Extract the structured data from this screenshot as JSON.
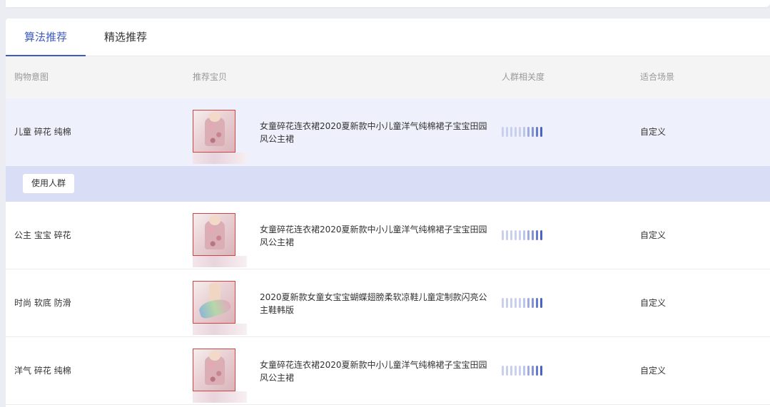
{
  "tabs": [
    {
      "label": "算法推荐",
      "active": true
    },
    {
      "label": "精选推荐",
      "active": false
    }
  ],
  "columns": {
    "intent": "购物意图",
    "product": "推荐宝贝",
    "relevance": "人群相关度",
    "scene": "适合场景"
  },
  "colors": {
    "accent": "#3d5ac1",
    "bar_light": "#c9d0ee",
    "bar_dark": "#4a62c6",
    "highlight_row": "#eef1fb",
    "action_row": "#d9ddf5"
  },
  "action": {
    "use_crowd_label": "使用人群"
  },
  "rows": [
    {
      "intent": "儿童 碎花 纯棉",
      "title": "女童碎花连衣裙2020夏新款中小儿童洋气纯棉裙子宝宝田园风公主裙",
      "thumb": "dress-thumbnail",
      "relevance_level": 0.5,
      "scene": "自定义"
    },
    {
      "intent": "公主 宝宝 碎花",
      "title": "女童碎花连衣裙2020夏新款中小儿童洋气纯棉裙子宝宝田园风公主裙",
      "thumb": "dress-thumbnail",
      "relevance_level": 0.5,
      "scene": "自定义"
    },
    {
      "intent": "时尚 软底 防滑",
      "title": "2020夏新款女童女宝宝蝴蝶翅膀柔软凉鞋儿童定制款闪亮公主鞋韩版",
      "thumb": "sandal-thumbnail",
      "relevance_level": 0.5,
      "scene": "自定义"
    },
    {
      "intent": "洋气 碎花 纯棉",
      "title": "女童碎花连衣裙2020夏新款中小儿童洋气纯棉裙子宝宝田园风公主裙",
      "thumb": "dress-thumbnail",
      "relevance_level": 0.5,
      "scene": "自定义"
    }
  ]
}
